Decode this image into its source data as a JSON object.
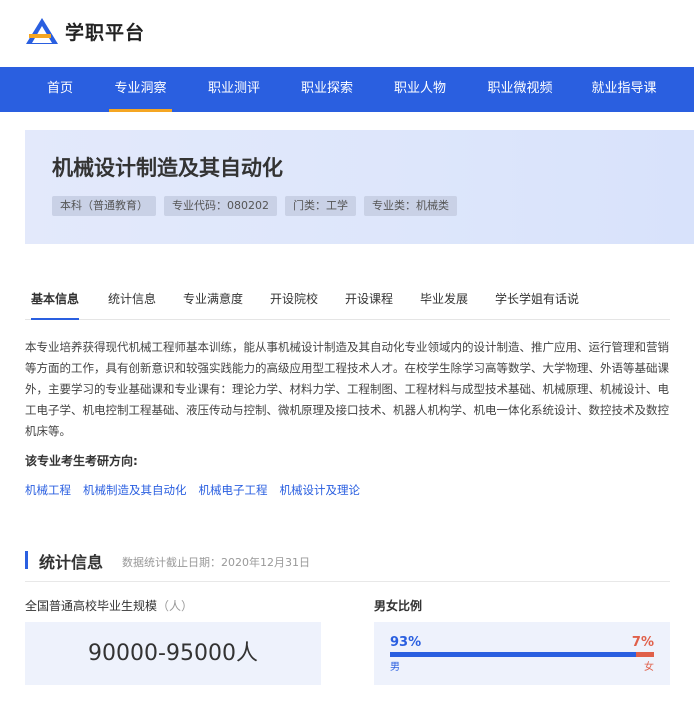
{
  "brand": {
    "name": "学职平台",
    "accent": "#2a5fe0",
    "logo_icon": "triangle-logo-icon"
  },
  "nav": {
    "items": [
      {
        "label": "首页",
        "active": false
      },
      {
        "label": "专业洞察",
        "active": true
      },
      {
        "label": "职业测评",
        "active": false
      },
      {
        "label": "职业探索",
        "active": false
      },
      {
        "label": "职业人物",
        "active": false
      },
      {
        "label": "职业微视频",
        "active": false
      },
      {
        "label": "就业指导课",
        "active": false
      }
    ]
  },
  "hero": {
    "title": "机械设计制造及其自动化",
    "tags": [
      "本科（普通教育）",
      "专业代码：080202",
      "门类：工学",
      "专业类：机械类"
    ]
  },
  "tabs": [
    {
      "label": "基本信息",
      "active": true
    },
    {
      "label": "统计信息",
      "active": false
    },
    {
      "label": "专业满意度",
      "active": false
    },
    {
      "label": "开设院校",
      "active": false
    },
    {
      "label": "开设课程",
      "active": false
    },
    {
      "label": "毕业发展",
      "active": false
    },
    {
      "label": "学长学姐有话说",
      "active": false
    }
  ],
  "description": "本专业培养获得现代机械工程师基本训练，能从事机械设计制造及其自动化专业领域内的设计制造、推广应用、运行管理和营销等方面的工作，具有创新意识和较强实践能力的高级应用型工程技术人才。在校学生除学习高等数学、大学物理、外语等基础课外，主要学习的专业基础课和专业课有：理论力学、材料力学、工程制图、工程材料与成型技术基础、机械原理、机械设计、电工电子学、机电控制工程基础、液压传动与控制、微机原理及接口技术、机器人机构学、机电一体化系统设计、数控技术及数控机床等。",
  "direction": {
    "title": "该专业考生考研方向:",
    "links": [
      "机械工程",
      "机械制造及其自动化",
      "机械电子工程",
      "机械设计及理论"
    ]
  },
  "stats": {
    "title": "统计信息",
    "date_label": "数据统计截止日期：2020年12月31日",
    "scale_label": "全国普通高校毕业生规模",
    "scale_unit": "（人）",
    "scale_value": "90000-95000人",
    "ratio_label": "男女比例",
    "male_pct": "93%",
    "female_pct": "7%",
    "male_fraction": 0.93,
    "male_label": "男",
    "female_label": "女",
    "male_color": "#2a5fe0",
    "female_color": "#e0604a"
  }
}
